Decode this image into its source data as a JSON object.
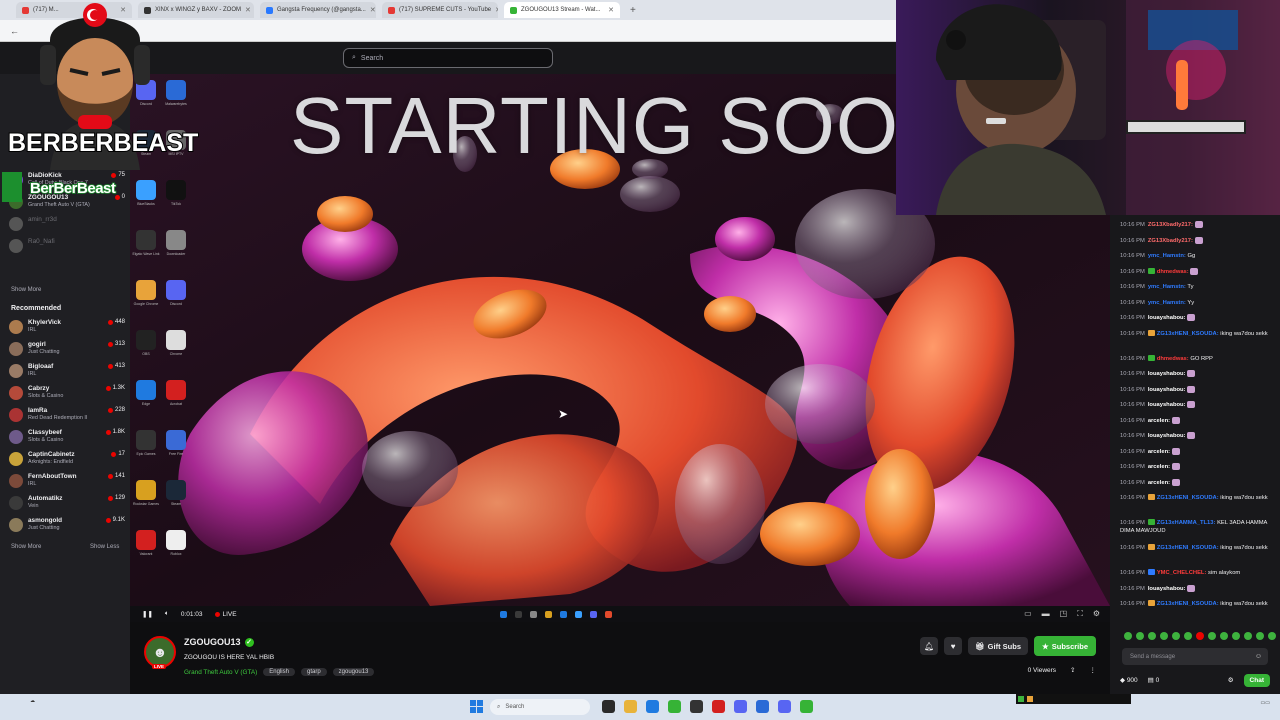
{
  "browser": {
    "tabs": [
      {
        "label": "(717) M...",
        "color": "#e53935"
      },
      {
        "label": "XINX x WINGZ y BAXV - ZOOM",
        "color": "#333333"
      },
      {
        "label": "Gangsta Frequency (@gangsta...",
        "color": "#2979ff"
      },
      {
        "label": "(717) SUPREME CUTS - YouTube",
        "color": "#e53935"
      },
      {
        "label": "ZGOUGOU13 Stream - Wat...",
        "color": "#36b336",
        "active": true
      }
    ],
    "new_tab": "+"
  },
  "twitch": {
    "search_placeholder": "Search"
  },
  "overlay": {
    "logo_text": "BERBERBEAST",
    "brand_text": "BerBerBeast"
  },
  "sidebar": {
    "followed": [
      {
        "name": "DiaDioKick",
        "game": "Call of Duty: Black Ops 7",
        "viewers": "75",
        "color": "#7a4fd6"
      },
      {
        "name": "ZGOUGOU13",
        "game": "Grand Theft Auto V (GTA)",
        "viewers": "0",
        "color": "#3c6b2b"
      },
      {
        "name": "amin_rr3d",
        "game": "",
        "viewers": "",
        "offline": true,
        "color": "#555"
      },
      {
        "name": "Ra0_Nafi",
        "game": "",
        "viewers": "",
        "offline": true,
        "color": "#555"
      }
    ],
    "show_more_1": "Show More",
    "recommended_heading": "Recommended",
    "recommended": [
      {
        "name": "KhylerVick",
        "game": "IRL",
        "viewers": "448",
        "color": "#ac7b4e"
      },
      {
        "name": "gogirl",
        "game": "Just Chatting",
        "viewers": "313",
        "color": "#8a6d5a"
      },
      {
        "name": "Bigloaaf",
        "game": "IRL",
        "viewers": "413",
        "color": "#9a7b66"
      },
      {
        "name": "Cabrzy",
        "game": "Slots & Casino",
        "viewers": "1.3K",
        "color": "#b54a3a"
      },
      {
        "name": "IamRa",
        "game": "Red Dead Redemption II",
        "viewers": "228",
        "color": "#a33"
      },
      {
        "name": "Classybeef",
        "game": "Slots & Casino",
        "viewers": "1.8K",
        "color": "#6e5a8a"
      },
      {
        "name": "CaptinCabinetz",
        "game": "Arknights: Endfield",
        "viewers": "17",
        "color": "#c9a33a"
      },
      {
        "name": "FernAboutTown",
        "game": "IRL",
        "viewers": "141",
        "color": "#7c4a3a"
      },
      {
        "name": "Automatikz",
        "game": "Vein",
        "viewers": "129",
        "color": "#3a3a3a"
      },
      {
        "name": "asmongold",
        "game": "Just Chatting",
        "viewers": "9.1K",
        "color": "#8a7a5a"
      }
    ],
    "show_more_2": "Show More",
    "show_less": "Show Less"
  },
  "video": {
    "overlay_text": "STARTING SOO",
    "elapsed": "0:01:03",
    "live_label": "LIVE",
    "desktop_icons": [
      {
        "label": "Discord",
        "color": "#5865f2"
      },
      {
        "label": "Malwarebytes",
        "color": "#2a6ad6"
      },
      {
        "label": "Steam",
        "color": "#1b2838"
      },
      {
        "label": "MSI IPTV",
        "color": "#666"
      },
      {
        "label": "BlueStacks",
        "color": "#3aa0ff"
      },
      {
        "label": "TikTok",
        "color": "#111"
      },
      {
        "label": "Elgato Wave Link",
        "color": "#333"
      },
      {
        "label": "Downloader",
        "color": "#888"
      },
      {
        "label": "Google Chrome",
        "color": "#e8a33a"
      },
      {
        "label": "Discord",
        "color": "#5865f2"
      },
      {
        "label": "OBS",
        "color": "#222"
      },
      {
        "label": "Chrome",
        "color": "#ddd"
      },
      {
        "label": "Edge",
        "color": "#1f7ae0"
      },
      {
        "label": "Acrobat",
        "color": "#d3201f"
      },
      {
        "label": "Epic Games",
        "color": "#333"
      },
      {
        "label": "Free Fire",
        "color": "#3a6ad6"
      },
      {
        "label": "Rockstar Games",
        "color": "#d8a01f"
      },
      {
        "label": "Steam",
        "color": "#1b2838"
      },
      {
        "label": "Valorant",
        "color": "#d3201f"
      },
      {
        "label": "Roblox",
        "color": "#eee"
      }
    ]
  },
  "stream": {
    "streamer": "ZGOUGOU13",
    "title": "ZGOUGOU IS HERE YAL HBIB",
    "game": "Grand Theft Auto V (GTA)",
    "tags": [
      "English",
      "gtarp",
      "zgougou13"
    ],
    "gift_subs": "Gift Subs",
    "subscribe": "Subscribe",
    "viewers": "0 Viewers"
  },
  "chat": {
    "messages": [
      {
        "time": "10:16 PM",
        "user": "ZG13Xbadly217:",
        "text": "",
        "color": "#ff6b6b",
        "badge": ""
      },
      {
        "time": "10:16 PM",
        "user": "ZG13Xbadly217:",
        "text": "",
        "color": "#ff6b6b",
        "badge": ""
      },
      {
        "time": "10:16 PM",
        "user": "ymc_Hamstn:",
        "text": "Gg",
        "color": "#2f7bff",
        "badge": ""
      },
      {
        "time": "10:16 PM",
        "user": "dhmedwas:",
        "text": "",
        "color": "#ff3b3b",
        "badge": "#36b336"
      },
      {
        "time": "10:16 PM",
        "user": "ymc_Hamstn:",
        "text": "Ty",
        "color": "#2f7bff",
        "badge": ""
      },
      {
        "time": "10:16 PM",
        "user": "ymc_Hamstn:",
        "text": "Yy",
        "color": "#2f7bff",
        "badge": ""
      },
      {
        "time": "10:16 PM",
        "user": "louayshabou:",
        "text": "",
        "color": "#ffffff",
        "badge": ""
      },
      {
        "time": "10:16 PM",
        "user": "ZG13xHENI_KSOUDA:",
        "text": "iking wa7dou sekk",
        "color": "#2f7bff",
        "badge": "#e8a33a"
      },
      {
        "time": "10:16 PM",
        "user": "dhmedwas:",
        "text": "GO RPP",
        "color": "#ff3b3b",
        "badge": "#36b336"
      },
      {
        "time": "10:16 PM",
        "user": "louayshabou:",
        "text": "",
        "color": "#ffffff",
        "badge": ""
      },
      {
        "time": "10:16 PM",
        "user": "louayshabou:",
        "text": "",
        "color": "#ffffff",
        "badge": ""
      },
      {
        "time": "10:16 PM",
        "user": "louayshabou:",
        "text": "",
        "color": "#ffffff",
        "badge": ""
      },
      {
        "time": "10:16 PM",
        "user": "arcelen:",
        "text": "",
        "color": "#ffffff",
        "badge": ""
      },
      {
        "time": "10:16 PM",
        "user": "louayshabou:",
        "text": "",
        "color": "#ffffff",
        "badge": ""
      },
      {
        "time": "10:16 PM",
        "user": "arcelen:",
        "text": "",
        "color": "#ffffff",
        "badge": ""
      },
      {
        "time": "10:16 PM",
        "user": "arcelen:",
        "text": "",
        "color": "#ffffff",
        "badge": ""
      },
      {
        "time": "10:16 PM",
        "user": "arcelen:",
        "text": "",
        "color": "#ffffff",
        "badge": ""
      },
      {
        "time": "10:16 PM",
        "user": "ZG13xHENI_KSOUDA:",
        "text": "iking wa7dou sekk",
        "color": "#2f7bff",
        "badge": "#e8a33a"
      },
      {
        "time": "10:16 PM",
        "user": "ZG13xHAMMA_TL13:",
        "text": "KEL 3ADA HAMMA DIMA MAWJOUD",
        "color": "#2f7bff",
        "badge": "#36b336"
      },
      {
        "time": "10:16 PM",
        "user": "ZG13xHENI_KSOUDA:",
        "text": "iking wa7dou sekk",
        "color": "#2f7bff",
        "badge": "#e8a33a"
      },
      {
        "time": "10:16 PM",
        "user": "YMC_CHELCHEL:",
        "text": "sim alaykom",
        "color": "#ff3b3b",
        "badge": "#2f7bff"
      },
      {
        "time": "10:16 PM",
        "user": "louayshabou:",
        "text": "",
        "color": "#ffffff",
        "badge": ""
      },
      {
        "time": "10:16 PM",
        "user": "ZG13xHENI_KSOUDA:",
        "text": "iking wa7dou sekk",
        "color": "#2f7bff",
        "badge": "#e8a33a"
      }
    ],
    "input_placeholder": "Send a message",
    "points": "900",
    "count": "0",
    "chat_button": "Chat"
  },
  "taskbar": {
    "search": "Search"
  }
}
